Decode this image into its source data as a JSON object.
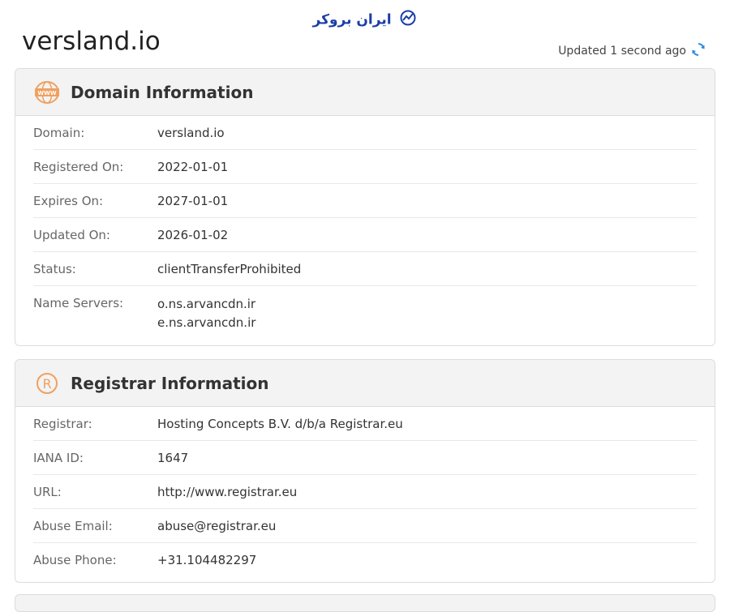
{
  "header": {
    "logo_text": "ایران بروکر",
    "domain_title": "versland.io",
    "updated_text": "Updated 1 second ago"
  },
  "domain_info": {
    "title": "Domain Information",
    "icon": "www-globe-icon",
    "rows": [
      {
        "label": "Domain:",
        "value": "versland.io"
      },
      {
        "label": "Registered On:",
        "value": "2022-01-01"
      },
      {
        "label": "Expires On:",
        "value": "2027-01-01"
      },
      {
        "label": "Updated On:",
        "value": "2026-01-02"
      },
      {
        "label": "Status:",
        "value": "clientTransferProhibited"
      }
    ],
    "name_servers": {
      "label": "Name Servers:",
      "values": [
        "o.ns.arvancdn.ir",
        "e.ns.arvancdn.ir"
      ]
    }
  },
  "registrar_info": {
    "title": "Registrar Information",
    "icon": "registered-mark-icon",
    "rows": [
      {
        "label": "Registrar:",
        "value": "Hosting Concepts B.V. d/b/a Registrar.eu"
      },
      {
        "label": "IANA ID:",
        "value": "1647"
      },
      {
        "label": "URL:",
        "value": "http://www.registrar.eu"
      },
      {
        "label": "Abuse Email:",
        "value": "abuse@registrar.eu"
      },
      {
        "label": "Abuse Phone:",
        "value": "+31.104482297"
      }
    ]
  },
  "colors": {
    "accent_orange": "#f0a060",
    "logo_blue": "#1a3ea8",
    "refresh_blue": "#2a8be0"
  }
}
